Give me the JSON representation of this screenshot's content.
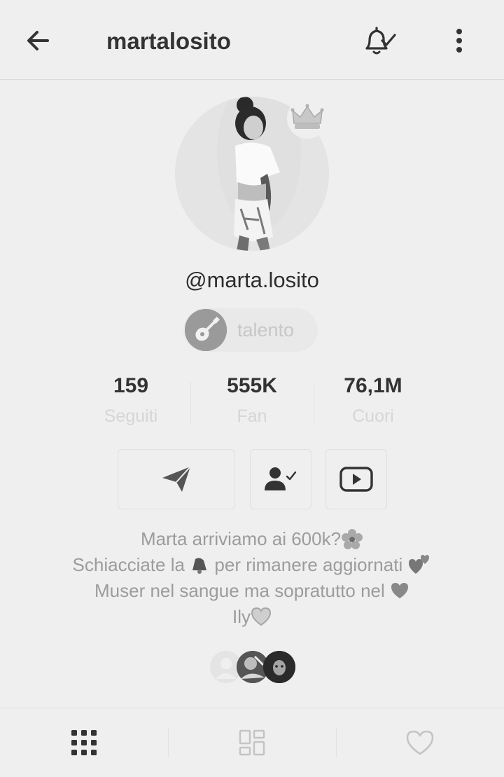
{
  "header": {
    "title": "martalosito",
    "back_icon": "arrow-left-icon",
    "notify_icon": "bell-check-icon",
    "more_icon": "more-vertical-icon"
  },
  "profile": {
    "handle": "@marta.losito",
    "badge_icon": "crown-icon",
    "talent": {
      "icon": "guitar-icon",
      "label": "talento"
    }
  },
  "stats": [
    {
      "value": "159",
      "label": "Seguiti"
    },
    {
      "value": "555K",
      "label": "Fan"
    },
    {
      "value": "76,1M",
      "label": "Cuori"
    }
  ],
  "actions": [
    {
      "icon": "send-icon"
    },
    {
      "icon": "user-following-icon"
    },
    {
      "icon": "youtube-icon"
    }
  ],
  "bio": {
    "line1": "Marta   arriviamo ai 600k?",
    "line2a": "Schiacciate la ",
    "line2b": " per rimanere aggiornati ",
    "line3": "Muser nel sangue ma sopratutto nel ",
    "line4": "Ily"
  },
  "tabs": [
    {
      "icon": "grid-icon",
      "active": true
    },
    {
      "icon": "duet-grid-icon",
      "active": false
    },
    {
      "icon": "heart-icon",
      "active": false
    }
  ],
  "colors": {
    "background": "#efefef",
    "text_dark": "#333333",
    "label_light": "#d6d6d6",
    "bio_gray": "#9c9c9c"
  }
}
